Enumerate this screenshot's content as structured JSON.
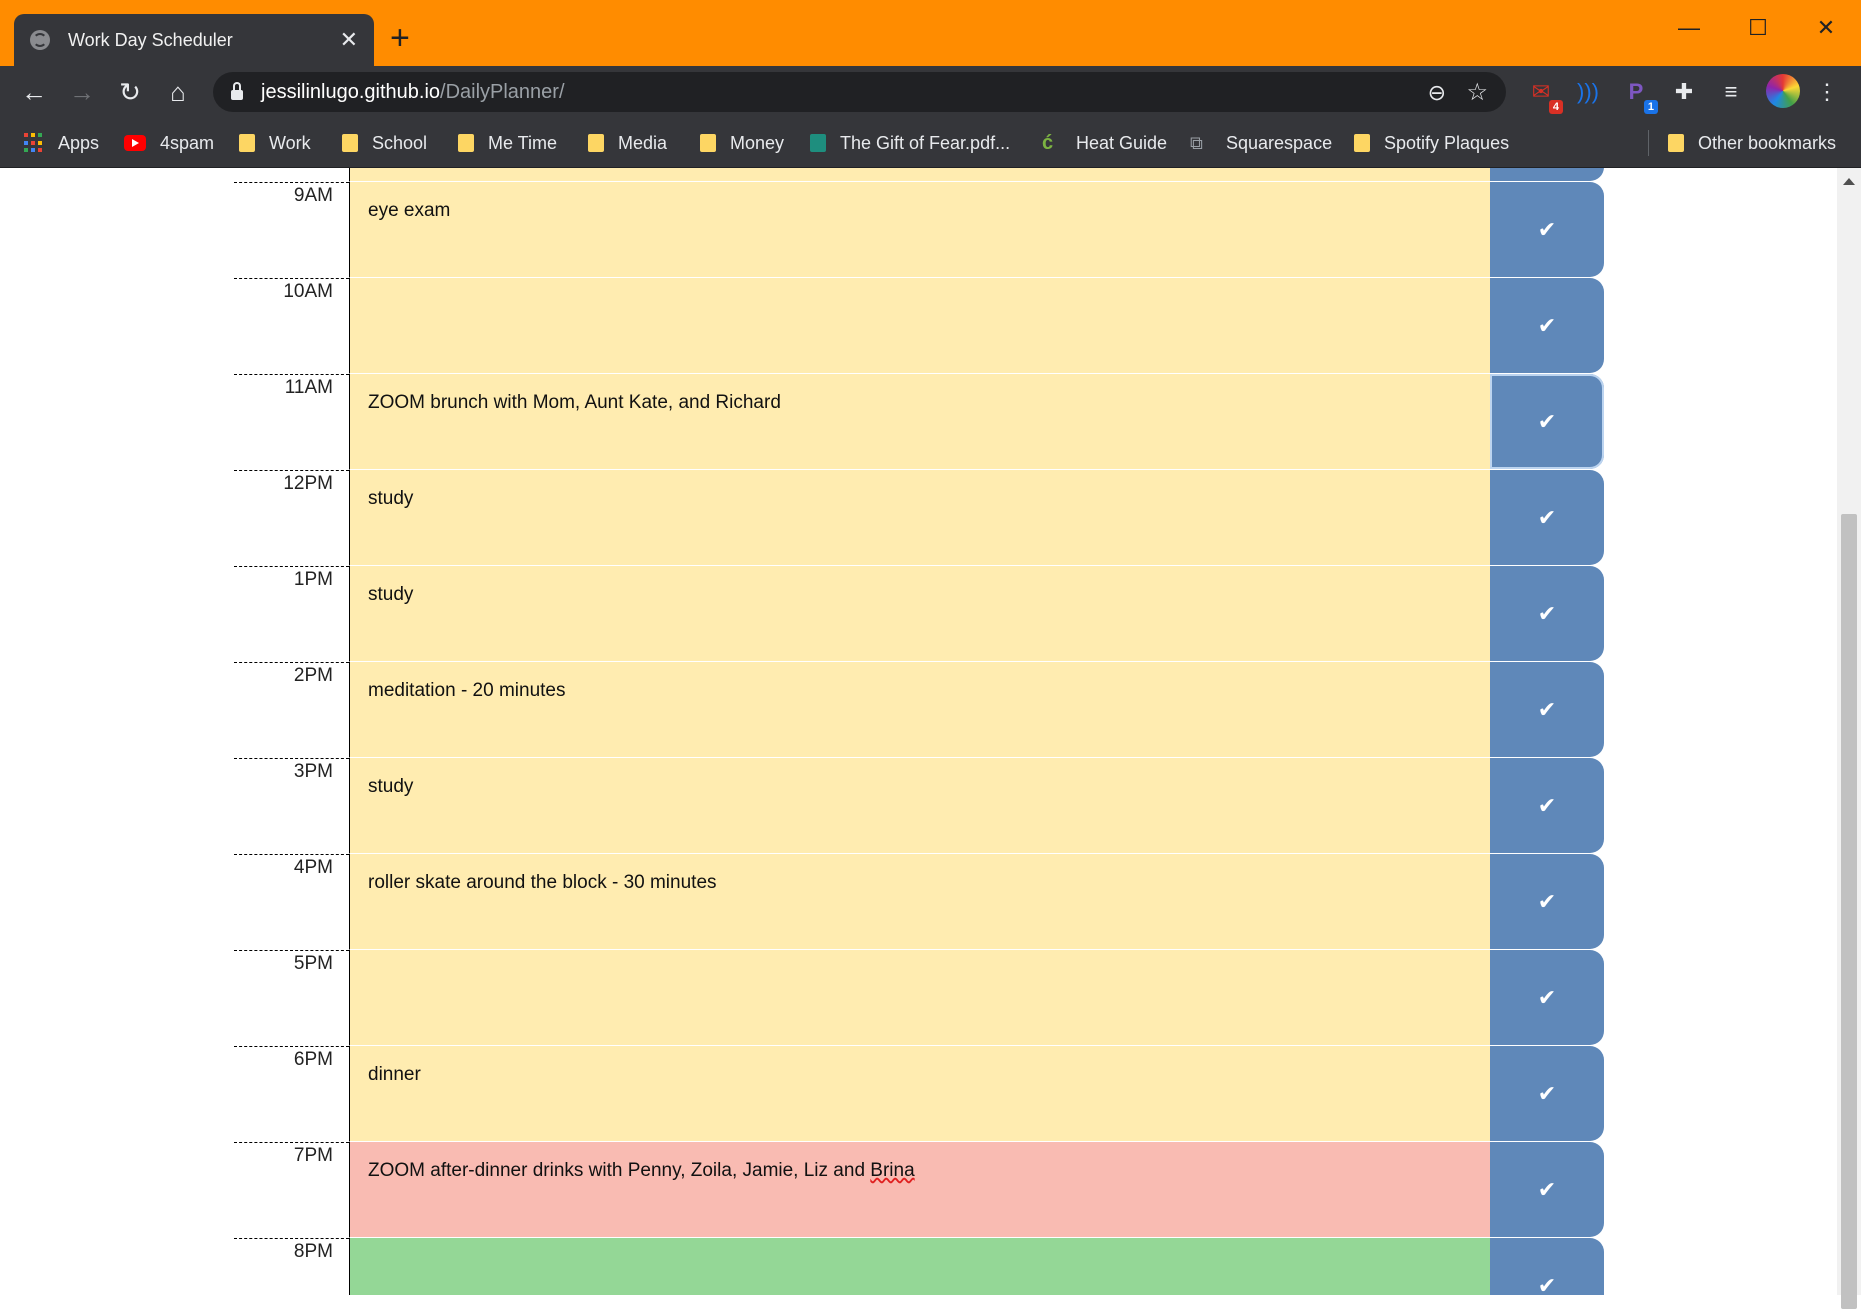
{
  "browser": {
    "tab_title": "Work Day Scheduler",
    "new_tab": "+",
    "window_controls": {
      "minimize": "—",
      "maximize": "☐",
      "close": "✕"
    },
    "url_host": "jessilinlugo.github.io",
    "url_path": "/DailyPlanner/",
    "extensions": {
      "gmail_badge": "4",
      "pocket_badge": "1"
    },
    "bookmarks": [
      "Apps",
      "4spam",
      "Work",
      "School",
      "Me Time",
      "Media",
      "Money",
      "The Gift of Fear.pdf...",
      "Heat Guide",
      "Squarespace",
      "Spotify Plaques"
    ],
    "other_bookmarks": "Other bookmarks"
  },
  "planner": {
    "rows": [
      {
        "hour": "9AM",
        "text": "eye exam",
        "state": "future"
      },
      {
        "hour": "10AM",
        "text": "",
        "state": "future"
      },
      {
        "hour": "11AM",
        "text": "ZOOM brunch with Mom, Aunt Kate, and Richard",
        "state": "future"
      },
      {
        "hour": "12PM",
        "text": "study",
        "state": "future"
      },
      {
        "hour": "1PM",
        "text": "study",
        "state": "future"
      },
      {
        "hour": "2PM",
        "text": "meditation - 20 minutes",
        "state": "future"
      },
      {
        "hour": "3PM",
        "text": "study",
        "state": "future"
      },
      {
        "hour": "4PM",
        "text": "roller skate around the block - 30 minutes",
        "state": "future"
      },
      {
        "hour": "5PM",
        "text": "",
        "state": "future"
      },
      {
        "hour": "6PM",
        "text": "dinner",
        "state": "future"
      },
      {
        "hour": "7PM",
        "text_before": "ZOOM after-dinner drinks with Penny, Zoila, Jamie, Liz and ",
        "text_misspelled": "Brina",
        "state": "present"
      },
      {
        "hour": "8PM",
        "text": "",
        "state": "past"
      }
    ],
    "save_icon": "✔",
    "colors": {
      "future": "#ffecb0",
      "present": "#f9bbb2",
      "past": "#94d796",
      "save": "#5f88b9"
    }
  }
}
